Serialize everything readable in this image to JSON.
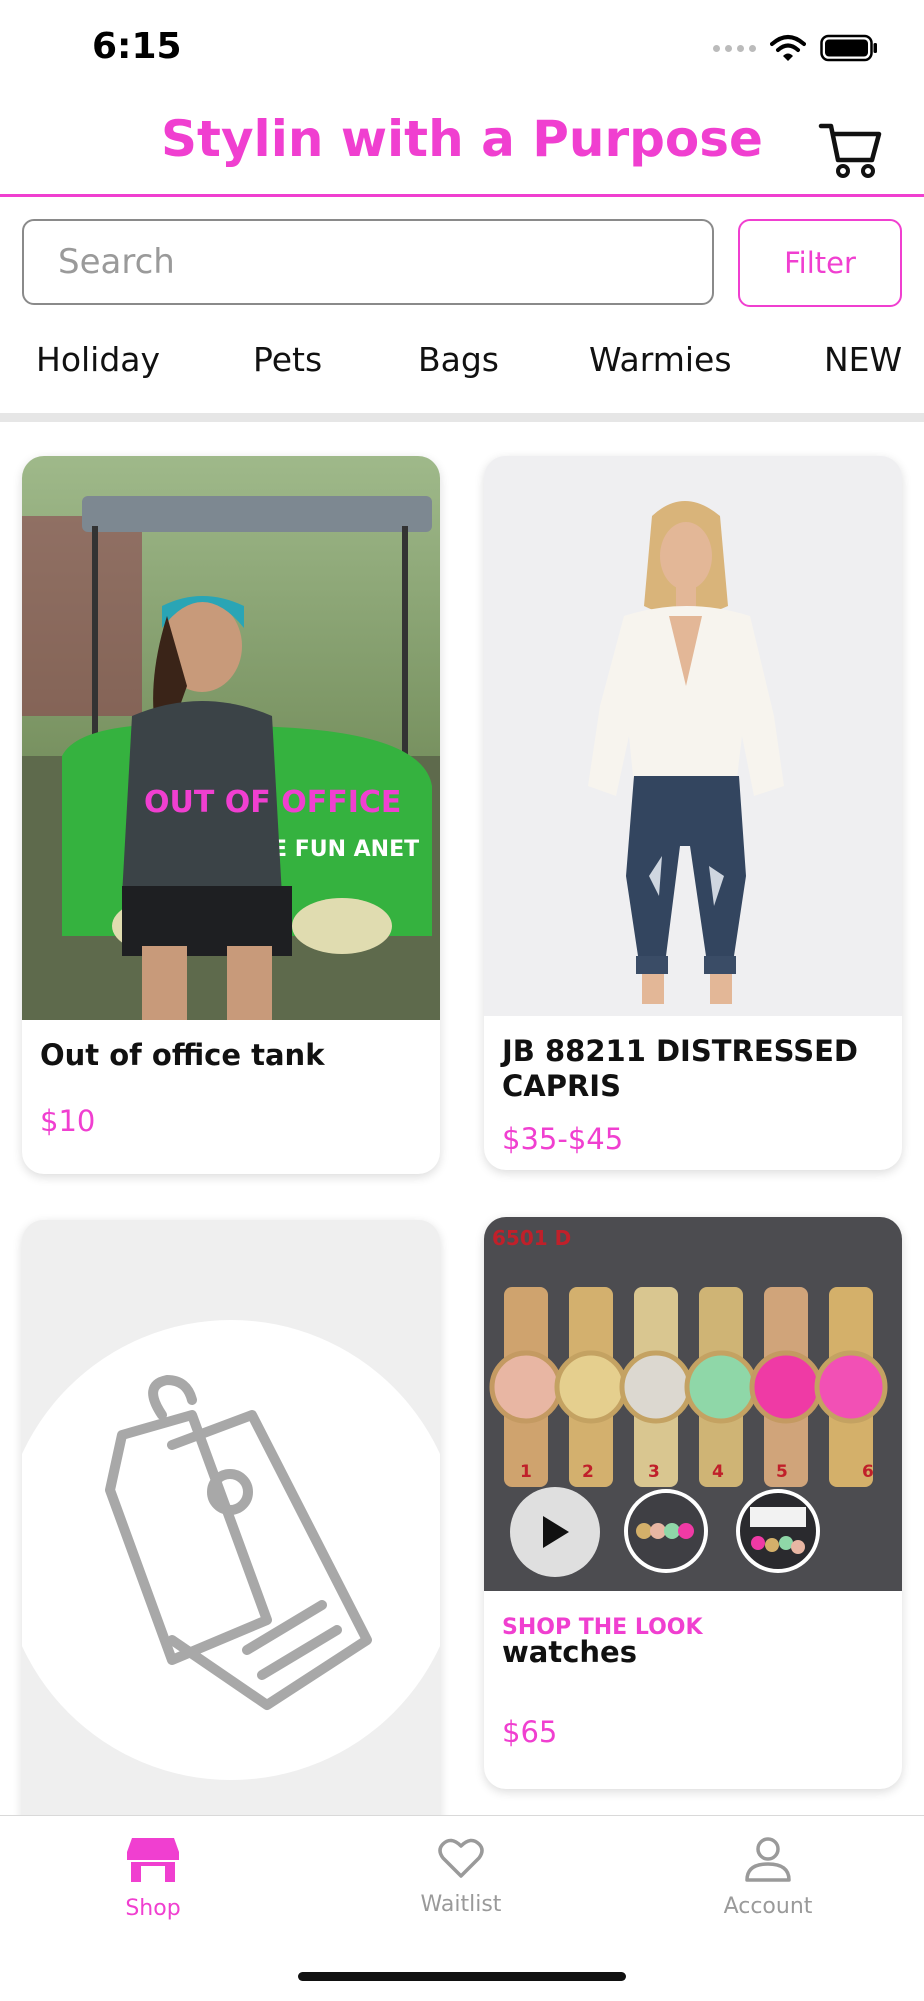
{
  "status_bar": {
    "time": "6:15"
  },
  "header": {
    "title": "Stylin with a Purpose"
  },
  "search": {
    "placeholder": "Search",
    "filter_label": "Filter"
  },
  "categories": [
    "Holiday",
    "Pets",
    "Bags",
    "Warmies",
    "NEW"
  ],
  "products": [
    {
      "name": "Out of office tank",
      "price": "$10",
      "shirt_text": "OUT OF OFFICE",
      "cart_text": "E FUN ANET"
    },
    {
      "name": "JB 88211 DISTRESSED CAPRIS",
      "price": "$35-$45"
    },
    {
      "name": "",
      "price": ""
    },
    {
      "tag": "SHOP THE LOOK",
      "name": "watches",
      "price": "$65",
      "sku_label": "6501 D",
      "watch_numbers": [
        "1",
        "2",
        "3",
        "4",
        "5",
        "6"
      ]
    }
  ],
  "bottom_nav": {
    "shop": "Shop",
    "waitlist": "Waitlist",
    "account": "Account"
  },
  "colors": {
    "accent": "#f03fd0",
    "inactive": "#9a9a9a"
  }
}
